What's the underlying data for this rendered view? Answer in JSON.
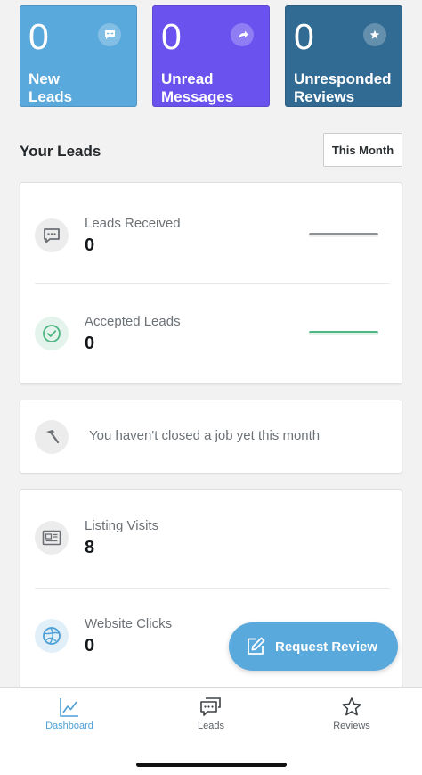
{
  "summary_tiles": [
    {
      "count": "0",
      "label_line1": "New",
      "label_line2": "Leads",
      "icon": "chat-bubble-icon",
      "color": "#5aa9dd"
    },
    {
      "count": "0",
      "label_line1": "Unread",
      "label_line2": "Messages",
      "icon": "share-arrow-icon",
      "color": "#6a52ef"
    },
    {
      "count": "0",
      "label_line1": "Unresponded",
      "label_line2": "Reviews",
      "icon": "star-icon",
      "color": "#316a92"
    }
  ],
  "leads_section": {
    "title": "Your Leads",
    "period": "This Month"
  },
  "leads_card": {
    "stats": [
      {
        "name": "Leads Received",
        "value": "0",
        "icon": "message-icon"
      },
      {
        "name": "Accepted Leads",
        "value": "0",
        "icon": "check-circle-icon"
      }
    ]
  },
  "job_notice": {
    "text": "You haven't closed a job yet this month",
    "icon": "hammer-icon"
  },
  "traffic_card": {
    "stats": [
      {
        "name": "Listing Visits",
        "value": "8",
        "icon": "listing-icon"
      },
      {
        "name": "Website Clicks",
        "value": "0",
        "icon": "globe-icon"
      }
    ]
  },
  "fab": {
    "label": "Request Review",
    "icon": "edit-icon"
  },
  "tabbar": {
    "tabs": [
      {
        "label": "Dashboard",
        "icon": "line-chart-icon",
        "active": true
      },
      {
        "label": "Leads",
        "icon": "chat-bubbles-icon",
        "active": false
      },
      {
        "label": "Reviews",
        "icon": "star-outline-icon",
        "active": false
      }
    ]
  },
  "colors": {
    "accent": "#5aa9dd",
    "purple": "#6a52ef",
    "navy": "#316a92",
    "success": "#4cb782"
  }
}
